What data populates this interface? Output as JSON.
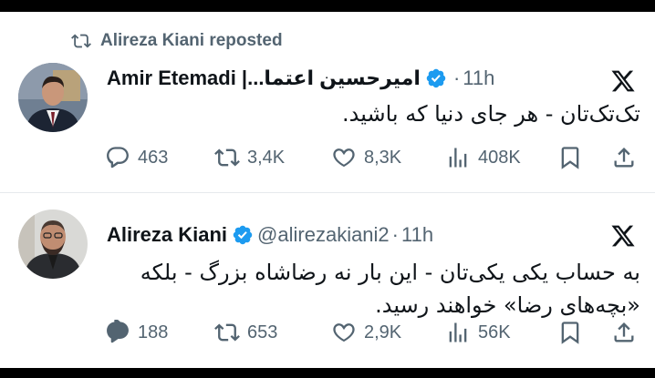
{
  "tweets": [
    {
      "repost_label": "Alireza Kiani reposted",
      "name_en": "Amir Etemadi | ",
      "name_fa": "امیرحسین اعتما...",
      "handle": "",
      "time": "11h",
      "text_lines": [
        "تک‌تک‌تان - هر جای دنیا که باشید."
      ],
      "stats": {
        "replies": "463",
        "reposts": "3,4K",
        "likes": "8,3K",
        "views": "408K"
      }
    },
    {
      "name_en": "Alireza Kiani",
      "handle": "@alirezakiani2",
      "time": "11h",
      "text_lines": [
        "به حساب یکی یکی‌تان - این بار نه رضاشاه بزرگ - بلکه",
        "«بچه‌های رضا» خواهند رسید."
      ],
      "stats": {
        "replies": "188",
        "reposts": "653",
        "likes": "2,9K",
        "views": "56K"
      }
    }
  ],
  "colors": {
    "verified": "#1d9bf0",
    "muted": "#536471",
    "text": "#0f1419",
    "divider": "#e6e9ec"
  },
  "icons": [
    "repost-icon",
    "verified-badge-icon",
    "x-logo-icon",
    "reply-icon",
    "like-icon",
    "views-icon",
    "bookmark-icon",
    "share-icon"
  ]
}
